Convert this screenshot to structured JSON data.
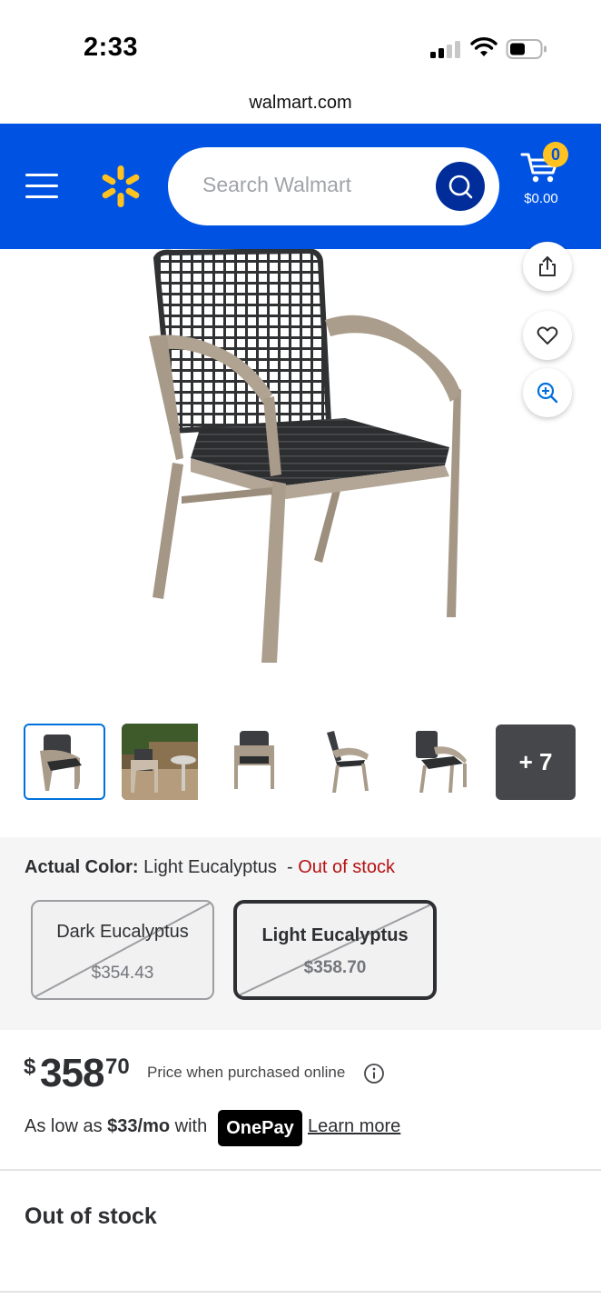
{
  "status_bar": {
    "time": "2:33"
  },
  "browser": {
    "url": "walmart.com"
  },
  "header": {
    "search_placeholder": "Search Walmart",
    "cart_count": "0",
    "cart_total": "$0.00",
    "brand_color": "#0053e2",
    "spark_color": "#ffc220"
  },
  "product": {
    "thumbnails_more": "+ 7",
    "actual_color_label": "Actual Color:",
    "actual_color_value": "Light Eucalyptus",
    "separator": "-",
    "stock_status": "Out of stock",
    "variants": [
      {
        "name": "Dark Eucalyptus",
        "price": "$354.43",
        "selected": false,
        "available": false
      },
      {
        "name": "Light Eucalyptus",
        "price": "$358.70",
        "selected": true,
        "available": false
      }
    ],
    "price": {
      "currency": "$",
      "dollars": "358",
      "cents": "70",
      "note": "Price when purchased online"
    },
    "financing": {
      "prefix": "As low as",
      "amount": "$33/mo",
      "with": "with",
      "provider": "OnePay",
      "link": "Learn more"
    },
    "availability_heading": "Out of stock"
  },
  "icons": [
    "share-icon",
    "heart-icon",
    "zoom-in-icon",
    "search-icon",
    "cart-icon",
    "menu-icon",
    "info-icon"
  ]
}
